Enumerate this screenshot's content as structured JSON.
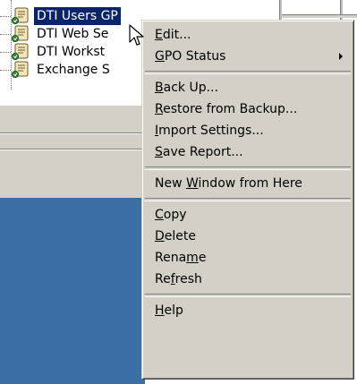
{
  "tree": {
    "items": [
      {
        "label": "DTI Users GP",
        "selected": true,
        "icon": "gpo-scroll-icon"
      },
      {
        "label": "DTI Web Se",
        "selected": false,
        "icon": "gpo-scroll-icon"
      },
      {
        "label": "DTI Workst",
        "selected": false,
        "icon": "gpo-scroll-icon"
      },
      {
        "label": "Exchange S",
        "selected": false,
        "icon": "gpo-scroll-icon"
      }
    ]
  },
  "context_menu": {
    "groups": [
      [
        {
          "pre": "",
          "u": "E",
          "post": "dit...",
          "submenu": false
        },
        {
          "pre": "",
          "u": "G",
          "post": "PO Status",
          "submenu": true
        }
      ],
      [
        {
          "pre": "",
          "u": "B",
          "post": "ack Up...",
          "submenu": false
        },
        {
          "pre": "",
          "u": "R",
          "post": "estore from Backup...",
          "submenu": false
        },
        {
          "pre": "",
          "u": "I",
          "post": "mport Settings...",
          "submenu": false
        },
        {
          "pre": "",
          "u": "S",
          "post": "ave Report...",
          "submenu": false
        }
      ],
      [
        {
          "pre": "New ",
          "u": "W",
          "post": "indow from Here",
          "submenu": false
        }
      ],
      [
        {
          "pre": "",
          "u": "C",
          "post": "opy",
          "submenu": false
        },
        {
          "pre": "",
          "u": "D",
          "post": "elete",
          "submenu": false
        },
        {
          "pre": "Rena",
          "u": "m",
          "post": "e",
          "submenu": false
        },
        {
          "pre": "Re",
          "u": "f",
          "post": "resh",
          "submenu": false
        }
      ],
      [
        {
          "pre": "",
          "u": "H",
          "post": "elp",
          "submenu": false
        }
      ]
    ]
  },
  "colors": {
    "menu_bg": "#d4d0c8",
    "selection": "#0a246a",
    "desktop_blue": "#3a6ea5"
  }
}
